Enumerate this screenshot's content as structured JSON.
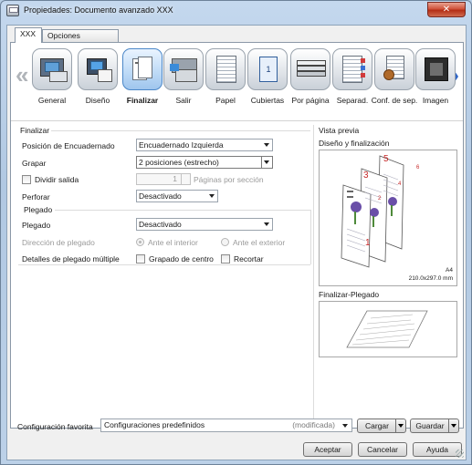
{
  "window": {
    "title": "Propiedades: Documento avanzado XXX",
    "close_glyph": "✕"
  },
  "tabs": [
    {
      "label": "XXX",
      "active": true
    },
    {
      "label": "Opciones avanzadas",
      "active": false
    }
  ],
  "iconbar": {
    "prev_arrow": "«",
    "next_arrow": "»",
    "items": [
      {
        "label": "General",
        "icon": "printer-monitor-icon"
      },
      {
        "label": "Diseño",
        "icon": "layout-icon"
      },
      {
        "label": "Finalizar",
        "icon": "finishing-icon",
        "active": true
      },
      {
        "label": "Salir",
        "icon": "output-tray-icon"
      },
      {
        "label": "Papel",
        "icon": "paper-icon"
      },
      {
        "label": "Cubiertas",
        "icon": "cover-icon"
      },
      {
        "label": "Por página",
        "icon": "per-page-icon"
      },
      {
        "label": "Separad.",
        "icon": "separator-icon"
      },
      {
        "label": "Conf. de sep.",
        "icon": "separator-settings-icon"
      },
      {
        "label": "Imagen",
        "icon": "image-icon"
      }
    ]
  },
  "finalizar": {
    "section_title": "Finalizar",
    "binding_label": "Posición de Encuadernado",
    "binding_value": "Encuadernado Izquierda",
    "staple_label": "Grapar",
    "staple_value": "2 posiciones (estrecho)",
    "split_label": "Dividir salida",
    "split_checked": false,
    "pages_per_section_value": "1",
    "pages_per_section_label": "Páginas por sección",
    "punch_label": "Perforar",
    "punch_value": "Desactivado"
  },
  "plegado": {
    "section_title": "Plegado",
    "fold_label": "Plegado",
    "fold_value": "Desactivado",
    "direction_label": "Dirección de plegado",
    "direction_inside": "Ante el interior",
    "direction_outside": "Ante el exterior",
    "direction_selected": "Ante el interior",
    "multi_fold_label": "Detalles de plegado múltiple",
    "center_staple_label": "Grapado de centro",
    "center_staple_checked": false,
    "trim_label": "Recortar",
    "trim_checked": false
  },
  "preview": {
    "title": "Vista previa",
    "layout_label": "Diseño y finalización",
    "page_numbers": [
      "5",
      "6",
      "3",
      "4",
      "2",
      "1"
    ],
    "paper_size": "A4",
    "paper_dimensions": "210.0x297.0 mm",
    "fold_label": "Finalizar-Plegado"
  },
  "favorites": {
    "label": "Configuración favorita",
    "value": "Configuraciones predefinidos",
    "modified_tag": "(modificada)",
    "load_button": "Cargar",
    "save_button": "Guardar"
  },
  "dialog_buttons": {
    "ok": "Aceptar",
    "cancel": "Cancelar",
    "help": "Ayuda"
  },
  "colors": {
    "accent": "#2f66c7",
    "page_number_red": "#c62828",
    "staple_grey": "#666666"
  }
}
